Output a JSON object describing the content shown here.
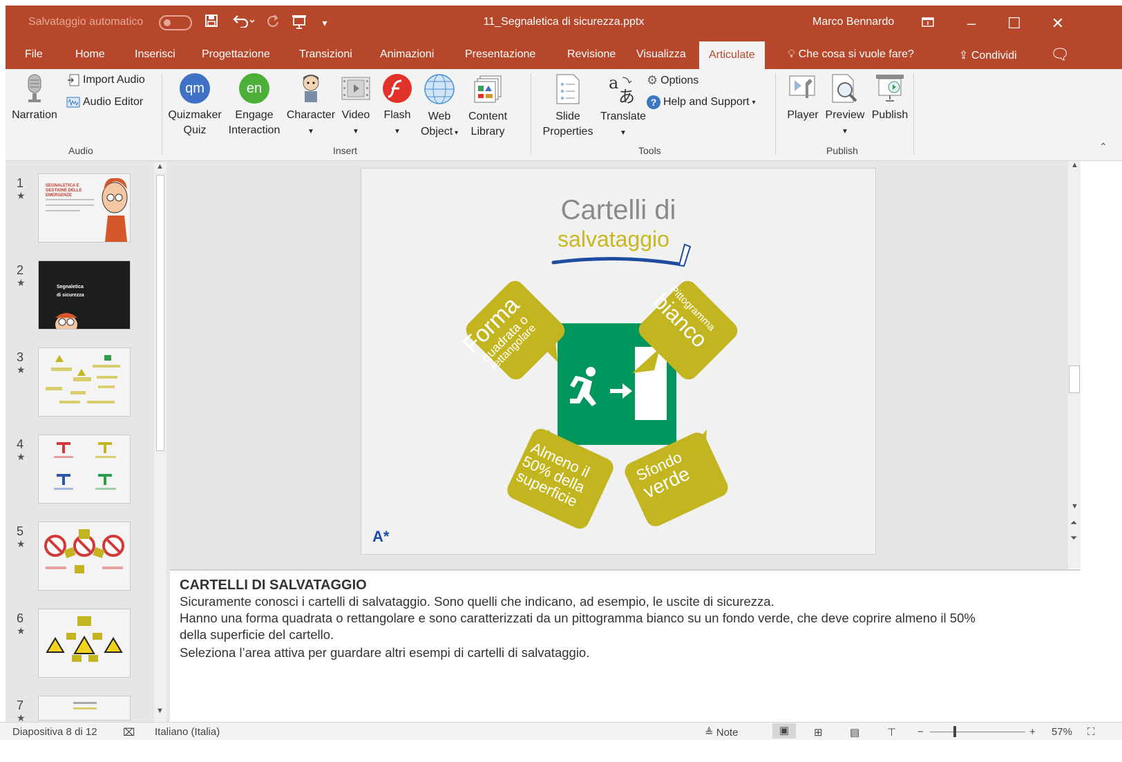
{
  "titlebar": {
    "autosave_label": "Salvataggio automatico",
    "doc_title": "11_Segnaletica di sicurezza.pptx",
    "user": "Marco Bennardo",
    "color": "#b7472a"
  },
  "tabs": [
    "File",
    "Home",
    "Inserisci",
    "Progettazione",
    "Transizioni",
    "Animazioni",
    "Presentazione",
    "Revisione",
    "Visualizza",
    "Articulate"
  ],
  "tell_me": "Che cosa si vuole fare?",
  "share": "Condividi",
  "ribbon": {
    "audio": {
      "narration": "Narration",
      "import_audio": "Import Audio",
      "audio_editor": "Audio Editor",
      "group": "Audio"
    },
    "insert": {
      "quizmaker": [
        "Quizmaker",
        "Quiz"
      ],
      "quizmaker_icon": "qm",
      "engage": [
        "Engage",
        "Interaction"
      ],
      "engage_icon": "en",
      "character": "Character",
      "video": "Video",
      "flash": "Flash",
      "web": [
        "Web",
        "Object"
      ],
      "content": [
        "Content",
        "Library"
      ],
      "group": "Insert"
    },
    "tools": {
      "slide_props": [
        "Slide",
        "Properties"
      ],
      "translate": "Translate",
      "options": "Options",
      "help": "Help and Support",
      "group": "Tools"
    },
    "publish": {
      "player": "Player",
      "preview": "Preview",
      "publish": "Publish",
      "group": "Publish"
    }
  },
  "thumbnails": {
    "numbers": [
      "1",
      "2",
      "3",
      "4",
      "5",
      "6",
      "7"
    ],
    "star": "★",
    "slide1_title": "SEGNALETICA E GESTIONE DELLE EMERGENZE",
    "slide2_title": [
      "Segnaletica",
      "di sicurezza"
    ]
  },
  "slide": {
    "title_line1": "Cartelli di",
    "title_line2": "salvataggio",
    "callouts": {
      "shape": [
        "Forma",
        "quadrata o",
        "rettangolare"
      ],
      "pictogram": [
        "Pittogramma",
        "bianco"
      ],
      "surface": [
        "Almeno il",
        "50% della",
        "superficie"
      ],
      "background": [
        "Sfondo",
        "verde"
      ]
    },
    "logo": "A*",
    "colors": {
      "yellow": "#c2b51f",
      "green": "#00965e",
      "blue_underline": "#1e4ca0"
    }
  },
  "notes": {
    "title": "CARTELLI DI SALVATAGGIO",
    "lines": [
      "Sicuramente conosci i cartelli di salvataggio. Sono quelli che indicano, ad esempio, le uscite di sicurezza.",
      "Hanno una forma quadrata o rettangolare e sono caratterizzati da un pittogramma bianco su un fondo verde, che deve coprire almeno il 50%",
      "della superficie del cartello.",
      "Seleziona l’area attiva per guardare altri esempi di cartelli di salvataggio."
    ]
  },
  "status": {
    "slide_info": "Diapositiva 8 di 12",
    "language": "Italiano (Italia)",
    "notes": "Note",
    "zoom": "57%"
  }
}
